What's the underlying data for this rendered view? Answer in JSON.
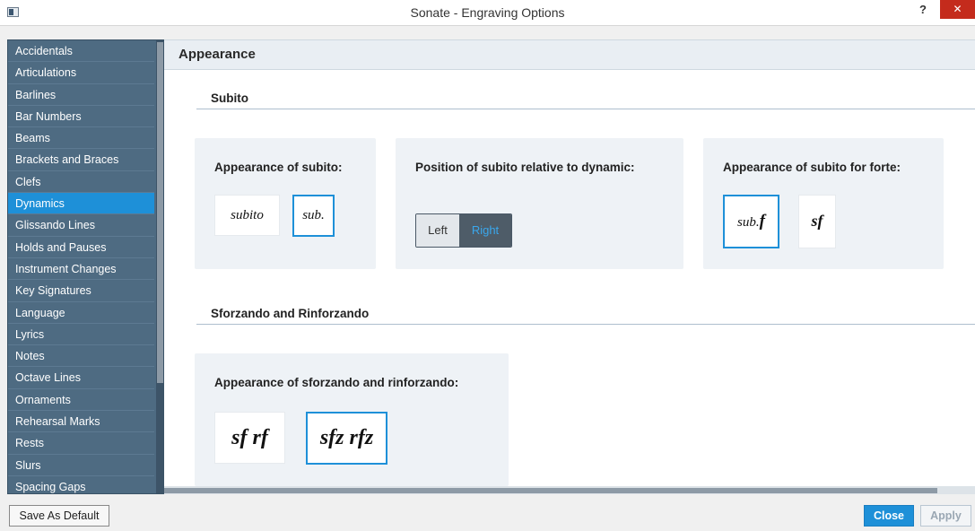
{
  "window": {
    "title": "Sonate - Engraving Options",
    "help_label": "?",
    "close_label": "✕"
  },
  "sidebar": {
    "items": [
      {
        "label": "Accidentals"
      },
      {
        "label": "Articulations"
      },
      {
        "label": "Barlines"
      },
      {
        "label": "Bar Numbers"
      },
      {
        "label": "Beams"
      },
      {
        "label": "Brackets and Braces"
      },
      {
        "label": "Clefs"
      },
      {
        "label": "Dynamics",
        "active": true
      },
      {
        "label": "Glissando Lines"
      },
      {
        "label": "Holds and Pauses"
      },
      {
        "label": "Instrument Changes"
      },
      {
        "label": "Key Signatures"
      },
      {
        "label": "Language"
      },
      {
        "label": "Lyrics"
      },
      {
        "label": "Notes"
      },
      {
        "label": "Octave Lines"
      },
      {
        "label": "Ornaments"
      },
      {
        "label": "Rehearsal Marks"
      },
      {
        "label": "Rests"
      },
      {
        "label": "Slurs"
      },
      {
        "label": "Spacing Gaps"
      }
    ]
  },
  "main": {
    "header": "Appearance",
    "subito": {
      "title": "Subito",
      "appearance": {
        "title": "Appearance of subito:",
        "options": [
          "subito",
          "sub."
        ],
        "selected": "sub."
      },
      "position": {
        "title": "Position of subito relative to dynamic:",
        "options": [
          "Left",
          "Right"
        ],
        "selected": "Right"
      },
      "forte": {
        "title": "Appearance of subito for forte:",
        "options": [
          "sub.𝆑",
          "sf"
        ],
        "option_labels": {
          "a_prefix": "sub.",
          "a_dyn": "f",
          "b": "sf"
        },
        "selected": "sub.𝆑"
      }
    },
    "sforzando": {
      "title": "Sforzando and Rinforzando",
      "appearance": {
        "title": "Appearance of sforzando and rinforzando:",
        "options": [
          "sf rf",
          "sfz rfz"
        ],
        "selected": "sfz rfz"
      }
    }
  },
  "footer": {
    "save_default": "Save As Default",
    "close": "Close",
    "apply": "Apply"
  },
  "colors": {
    "accent": "#1e90d8",
    "sidebar_bg": "#4e6b82",
    "card_bg": "#eef2f6"
  }
}
